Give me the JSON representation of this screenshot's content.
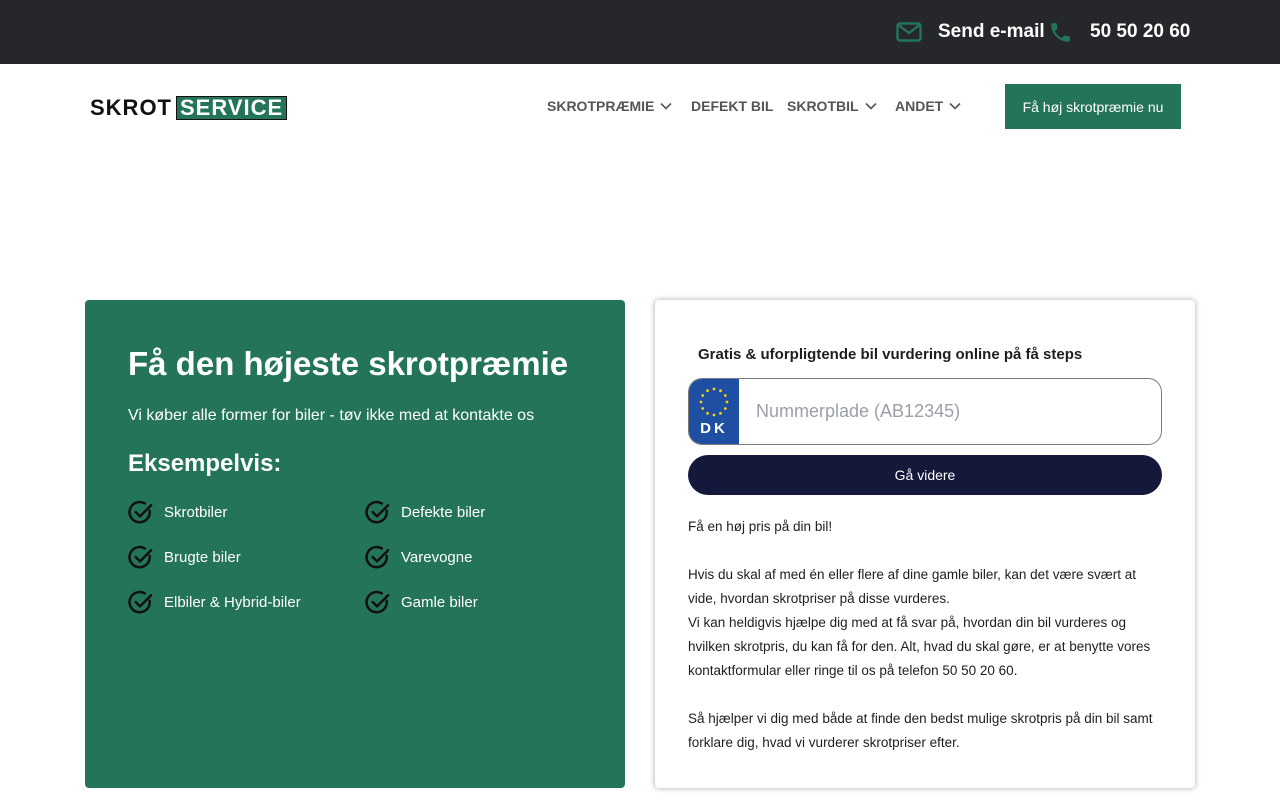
{
  "topbar": {
    "email_label": "Send e-mail",
    "phone_label": "50 50 20 60",
    "icon_color": "#24745a"
  },
  "header": {
    "logo_part1": "SKROT",
    "logo_part2": "SERVICE",
    "nav": [
      {
        "label": "SKROTPRÆMIE",
        "has_dropdown": true
      },
      {
        "label": "DEFEKT BIL",
        "has_dropdown": false
      },
      {
        "label": "SKROTBIL",
        "has_dropdown": true
      },
      {
        "label": "ANDET",
        "has_dropdown": true
      }
    ],
    "cta_label": "Få høj skrotpræmie nu"
  },
  "hero": {
    "title": "Få den højeste skrotpræmie",
    "subtitle": "Vi køber alle former for biler - tøv ikke med at kontakte os",
    "examples_heading": "Eksempelvis:",
    "examples": [
      "Skrotbiler",
      "Defekte biler",
      "Brugte biler",
      "Varevogne",
      "Elbiler & Hybrid-biler",
      "Gamle biler"
    ],
    "card_color": "#24745a"
  },
  "form": {
    "title": "Gratis & uforpligtende bil vurdering online på få steps",
    "plate_country": "DK",
    "plate_placeholder": "Nummerplade (AB12345)",
    "plate_value": "",
    "submit_label": "Gå videre",
    "intro": "Få en høj pris på din bil!",
    "para1": "Hvis du skal af med én eller flere af dine gamle biler, kan det være svært at vide, hvordan skrotpriser på disse vurderes.",
    "para2": "Vi kan heldigvis hjælpe dig med at få svar på, hvordan din bil vurderes og hvilken skrotpris, du kan få for den. Alt, hvad du skal gøre, er at benytte vores kontaktformular eller ringe til os på telefon 50 50 20 60.",
    "para3": "Så hjælper vi dig med både at finde den bedst mulige skrotpris på din bil samt forklare dig, hvad vi vurderer skrotpriser efter."
  }
}
